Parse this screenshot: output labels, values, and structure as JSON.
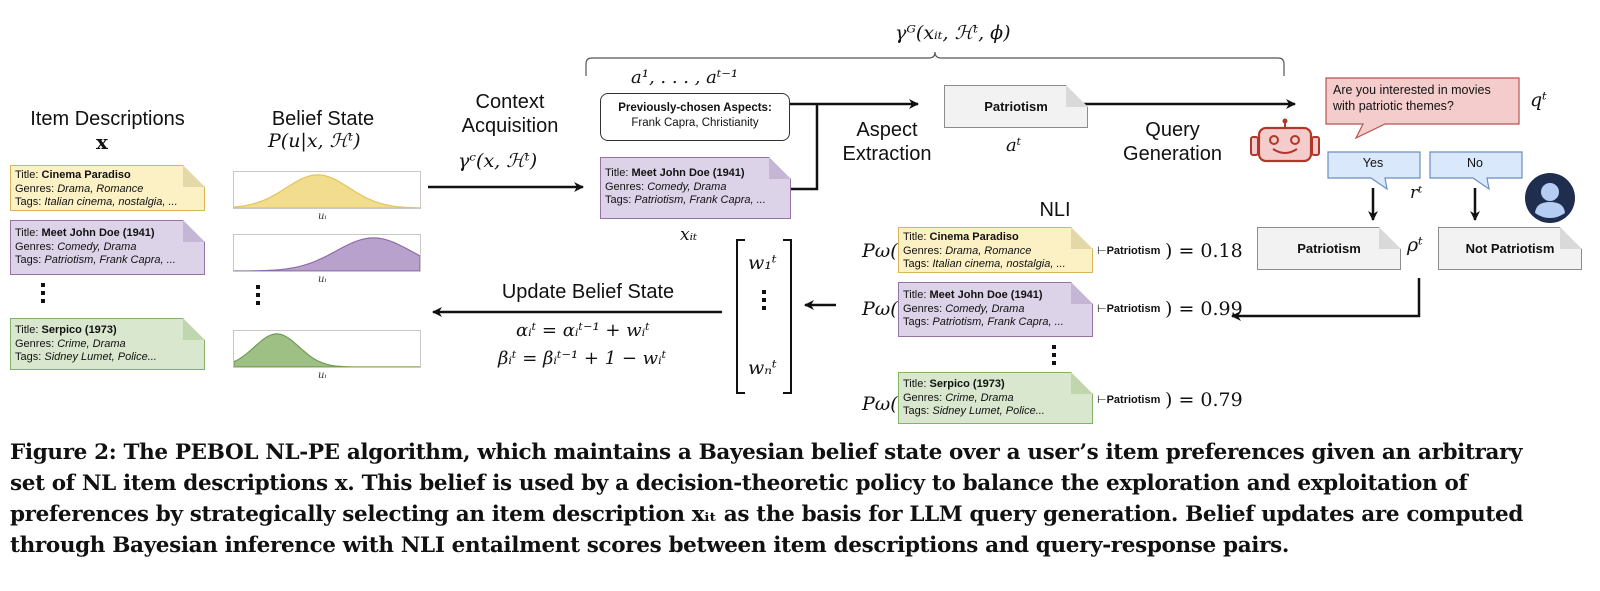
{
  "figure": {
    "sections": {
      "item_descriptions": {
        "title": "Item Descriptions",
        "symbol": "x"
      },
      "belief_state": {
        "title": "Belief State",
        "symbol": "P(u|x, ℋᵗ)"
      },
      "context_acquisition": {
        "line1": "Context",
        "line2": "Acquisition",
        "symbol": "γᶜ(x, ℋᵗ)"
      },
      "aspect_extraction": {
        "line1": "Aspect",
        "line2": "Extraction"
      },
      "query_generation": {
        "line1": "Query",
        "line2": "Generation"
      },
      "nli": {
        "title": "NLI"
      },
      "update_belief": {
        "title": "Update Belief State",
        "eq1": "αᵢᵗ = αᵢᵗ⁻¹ + wᵢᵗ",
        "eq2": "βᵢᵗ = βᵢᵗ⁻¹ + 1 − wᵢᵗ"
      }
    },
    "brace_label": "γᴳ(xᵢₜ, ℋᵗ, ϕ)",
    "prev_aspects_symbol": "a¹, . . . , aᵗ⁻¹",
    "prev_aspects": {
      "heading": "Previously-chosen Aspects:",
      "values": "Frank Capra, Christianity"
    },
    "items": [
      {
        "title": "Cinema Paradiso",
        "genres": "Drama, Romance",
        "tags": "Italian cinema, nostalgia, ...",
        "color": "yellow"
      },
      {
        "title": "Meet John Doe (1941)",
        "genres": "Comedy, Drama",
        "tags": "Patriotism, Frank Capra, ...",
        "color": "purple"
      },
      {
        "title": "Serpico (1973)",
        "genres": "Crime, Drama",
        "tags": "Sidney Lumet, Police...",
        "color": "green"
      }
    ],
    "field_labels": {
      "title": "Title: ",
      "genres": "Genres: ",
      "tags": "Tags: "
    },
    "selected_item": {
      "title": "Meet John Doe (1941)",
      "genres": "Comedy, Drama",
      "tags": "Patriotism, Frank Capra, ...",
      "symbol": "xᵢₜ"
    },
    "belief_axis_label": "uᵢ",
    "belief_distributions": [
      {
        "name": "Cinema Paradiso",
        "mean": 0.45,
        "spread": 0.17,
        "color": "#f2dc8e",
        "stroke": "#e0c45c"
      },
      {
        "name": "Meet John Doe (1941)",
        "mean": 0.75,
        "spread": 0.2,
        "color": "#b8a1cc",
        "stroke": "#8e6aa8"
      },
      {
        "name": "Serpico (1973)",
        "mean": 0.23,
        "spread": 0.12,
        "color": "#9fc084",
        "stroke": "#6e9a52"
      }
    ],
    "aspect": {
      "value": "Patriotism",
      "symbol": "aᵗ"
    },
    "query": {
      "text_line1": "Are you interested in movies",
      "text_line2": "with patriotic themes?",
      "symbol": "qᵗ"
    },
    "responses": {
      "yes": "Yes",
      "no": "No",
      "symbol": "rᵗ"
    },
    "rho": {
      "positive": "Patriotism",
      "negative": "Not Patriotism",
      "symbol": "ρᵗ"
    },
    "nli_rows": [
      {
        "prefix": "Pω(",
        "hypothesis": "Patriotism",
        "score": "0.18"
      },
      {
        "prefix": "Pω(",
        "hypothesis": "Patriotism",
        "score": "0.99"
      },
      {
        "prefix": "Pω(",
        "hypothesis": "Patriotism",
        "score": "0.79"
      }
    ],
    "weights": {
      "first": "w₁ᵗ",
      "last": "wₙᵗ"
    },
    "colors": {
      "robot": "#b0382a",
      "robot_fill": "#f4cccc",
      "query_bubble": "#f4cccc",
      "query_border": "#b85450",
      "response_bubble": "#dae8fc",
      "response_border": "#6c8ebf",
      "user_icon": "#1f2d4f",
      "user_icon_light": "#b5cdf2"
    }
  },
  "caption": {
    "lines": [
      "Figure 2: The PEBOL NL-PE algorithm, which maintains a Bayesian belief state over a user’s item preferences given an arbitrary",
      "set of NL item descriptions x. This belief is used by a decision-theoretic policy to balance the exploration and exploitation of",
      "preferences by strategically selecting an item description xᵢₜ as the basis for LLM query generation. Belief updates are computed",
      "through Bayesian inference with NLI entailment scores between item descriptions and query-response pairs."
    ]
  }
}
